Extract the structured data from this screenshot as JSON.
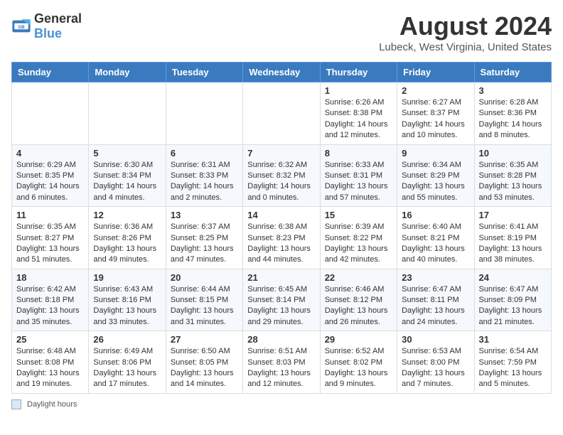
{
  "logo": {
    "general": "General",
    "blue": "Blue"
  },
  "title": "August 2024",
  "location": "Lubeck, West Virginia, United States",
  "legend": {
    "label": "Daylight hours"
  },
  "days_of_week": [
    "Sunday",
    "Monday",
    "Tuesday",
    "Wednesday",
    "Thursday",
    "Friday",
    "Saturday"
  ],
  "weeks": [
    [
      {
        "day": "",
        "info": ""
      },
      {
        "day": "",
        "info": ""
      },
      {
        "day": "",
        "info": ""
      },
      {
        "day": "",
        "info": ""
      },
      {
        "day": "1",
        "info": "Sunrise: 6:26 AM\nSunset: 8:38 PM\nDaylight: 14 hours and 12 minutes."
      },
      {
        "day": "2",
        "info": "Sunrise: 6:27 AM\nSunset: 8:37 PM\nDaylight: 14 hours and 10 minutes."
      },
      {
        "day": "3",
        "info": "Sunrise: 6:28 AM\nSunset: 8:36 PM\nDaylight: 14 hours and 8 minutes."
      }
    ],
    [
      {
        "day": "4",
        "info": "Sunrise: 6:29 AM\nSunset: 8:35 PM\nDaylight: 14 hours and 6 minutes."
      },
      {
        "day": "5",
        "info": "Sunrise: 6:30 AM\nSunset: 8:34 PM\nDaylight: 14 hours and 4 minutes."
      },
      {
        "day": "6",
        "info": "Sunrise: 6:31 AM\nSunset: 8:33 PM\nDaylight: 14 hours and 2 minutes."
      },
      {
        "day": "7",
        "info": "Sunrise: 6:32 AM\nSunset: 8:32 PM\nDaylight: 14 hours and 0 minutes."
      },
      {
        "day": "8",
        "info": "Sunrise: 6:33 AM\nSunset: 8:31 PM\nDaylight: 13 hours and 57 minutes."
      },
      {
        "day": "9",
        "info": "Sunrise: 6:34 AM\nSunset: 8:29 PM\nDaylight: 13 hours and 55 minutes."
      },
      {
        "day": "10",
        "info": "Sunrise: 6:35 AM\nSunset: 8:28 PM\nDaylight: 13 hours and 53 minutes."
      }
    ],
    [
      {
        "day": "11",
        "info": "Sunrise: 6:35 AM\nSunset: 8:27 PM\nDaylight: 13 hours and 51 minutes."
      },
      {
        "day": "12",
        "info": "Sunrise: 6:36 AM\nSunset: 8:26 PM\nDaylight: 13 hours and 49 minutes."
      },
      {
        "day": "13",
        "info": "Sunrise: 6:37 AM\nSunset: 8:25 PM\nDaylight: 13 hours and 47 minutes."
      },
      {
        "day": "14",
        "info": "Sunrise: 6:38 AM\nSunset: 8:23 PM\nDaylight: 13 hours and 44 minutes."
      },
      {
        "day": "15",
        "info": "Sunrise: 6:39 AM\nSunset: 8:22 PM\nDaylight: 13 hours and 42 minutes."
      },
      {
        "day": "16",
        "info": "Sunrise: 6:40 AM\nSunset: 8:21 PM\nDaylight: 13 hours and 40 minutes."
      },
      {
        "day": "17",
        "info": "Sunrise: 6:41 AM\nSunset: 8:19 PM\nDaylight: 13 hours and 38 minutes."
      }
    ],
    [
      {
        "day": "18",
        "info": "Sunrise: 6:42 AM\nSunset: 8:18 PM\nDaylight: 13 hours and 35 minutes."
      },
      {
        "day": "19",
        "info": "Sunrise: 6:43 AM\nSunset: 8:16 PM\nDaylight: 13 hours and 33 minutes."
      },
      {
        "day": "20",
        "info": "Sunrise: 6:44 AM\nSunset: 8:15 PM\nDaylight: 13 hours and 31 minutes."
      },
      {
        "day": "21",
        "info": "Sunrise: 6:45 AM\nSunset: 8:14 PM\nDaylight: 13 hours and 29 minutes."
      },
      {
        "day": "22",
        "info": "Sunrise: 6:46 AM\nSunset: 8:12 PM\nDaylight: 13 hours and 26 minutes."
      },
      {
        "day": "23",
        "info": "Sunrise: 6:47 AM\nSunset: 8:11 PM\nDaylight: 13 hours and 24 minutes."
      },
      {
        "day": "24",
        "info": "Sunrise: 6:47 AM\nSunset: 8:09 PM\nDaylight: 13 hours and 21 minutes."
      }
    ],
    [
      {
        "day": "25",
        "info": "Sunrise: 6:48 AM\nSunset: 8:08 PM\nDaylight: 13 hours and 19 minutes."
      },
      {
        "day": "26",
        "info": "Sunrise: 6:49 AM\nSunset: 8:06 PM\nDaylight: 13 hours and 17 minutes."
      },
      {
        "day": "27",
        "info": "Sunrise: 6:50 AM\nSunset: 8:05 PM\nDaylight: 13 hours and 14 minutes."
      },
      {
        "day": "28",
        "info": "Sunrise: 6:51 AM\nSunset: 8:03 PM\nDaylight: 13 hours and 12 minutes."
      },
      {
        "day": "29",
        "info": "Sunrise: 6:52 AM\nSunset: 8:02 PM\nDaylight: 13 hours and 9 minutes."
      },
      {
        "day": "30",
        "info": "Sunrise: 6:53 AM\nSunset: 8:00 PM\nDaylight: 13 hours and 7 minutes."
      },
      {
        "day": "31",
        "info": "Sunrise: 6:54 AM\nSunset: 7:59 PM\nDaylight: 13 hours and 5 minutes."
      }
    ]
  ]
}
